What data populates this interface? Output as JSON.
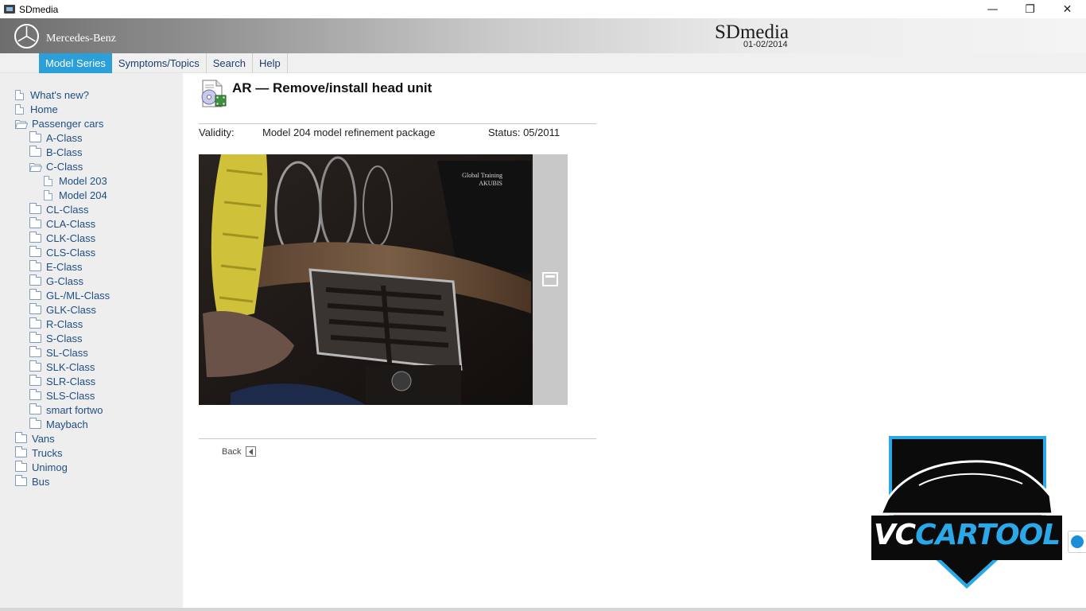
{
  "window": {
    "title": "SDmedia",
    "minimize": "—",
    "restore": "❐",
    "close": "✕"
  },
  "header": {
    "brand": "Mercedes-Benz",
    "app_title": "SDmedia",
    "date": "01-02/2014"
  },
  "nav": {
    "tabs": [
      {
        "label": "Model Series",
        "active": true
      },
      {
        "label": "Symptoms/Topics"
      },
      {
        "label": "Search"
      },
      {
        "label": "Help"
      }
    ]
  },
  "sidebar": {
    "items": [
      {
        "label": "What's new?",
        "icon": "document-icon"
      },
      {
        "label": "Home",
        "icon": "document-icon"
      },
      {
        "label": "Passenger cars",
        "icon": "folder-open-icon"
      },
      {
        "label": "A-Class",
        "icon": "folder-icon"
      },
      {
        "label": "B-Class",
        "icon": "folder-icon"
      },
      {
        "label": "C-Class",
        "icon": "folder-open-icon"
      },
      {
        "label": "Model 203",
        "icon": "document-icon"
      },
      {
        "label": "Model 204",
        "icon": "document-icon"
      },
      {
        "label": "CL-Class",
        "icon": "folder-icon"
      },
      {
        "label": "CLA-Class",
        "icon": "folder-icon"
      },
      {
        "label": "CLK-Class",
        "icon": "folder-icon"
      },
      {
        "label": "CLS-Class",
        "icon": "folder-icon"
      },
      {
        "label": "E-Class",
        "icon": "folder-icon"
      },
      {
        "label": "G-Class",
        "icon": "folder-icon"
      },
      {
        "label": "GL-/ML-Class",
        "icon": "folder-icon"
      },
      {
        "label": "GLK-Class",
        "icon": "folder-icon"
      },
      {
        "label": "R-Class",
        "icon": "folder-icon"
      },
      {
        "label": "S-Class",
        "icon": "folder-icon"
      },
      {
        "label": "SL-Class",
        "icon": "folder-icon"
      },
      {
        "label": "SLK-Class",
        "icon": "folder-icon"
      },
      {
        "label": "SLR-Class",
        "icon": "folder-icon"
      },
      {
        "label": "SLS-Class",
        "icon": "folder-icon"
      },
      {
        "label": "smart fortwo",
        "icon": "folder-icon"
      },
      {
        "label": "Maybach",
        "icon": "folder-icon"
      },
      {
        "label": "Vans",
        "icon": "folder-icon"
      },
      {
        "label": "Trucks",
        "icon": "folder-icon"
      },
      {
        "label": "Unimog",
        "icon": "folder-icon"
      },
      {
        "label": "Bus",
        "icon": "folder-icon"
      }
    ]
  },
  "content": {
    "heading": "AR — Remove/install head unit",
    "validity_label": "Validity:",
    "validity_value": "Model 204 model refinement package",
    "status": "Status: 05/2011",
    "video_caption_line1": "Global Training",
    "video_caption_line2": "AKUBIS",
    "back_label": "Back"
  },
  "watermark": {
    "text_part1": "VC",
    "text_part2": "CARTOOL"
  },
  "colors": {
    "nav_active": "#2a9fd8",
    "link": "#1f4e84",
    "logo_blue": "#2aa8e8"
  }
}
